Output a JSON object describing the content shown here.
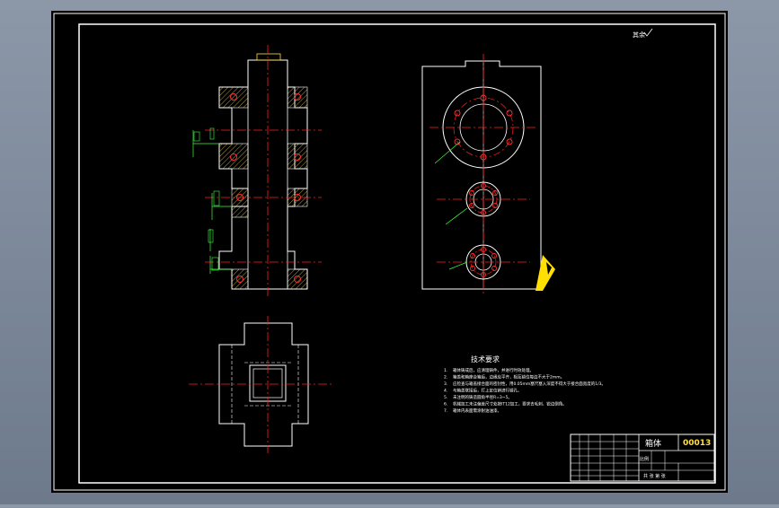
{
  "drawing": {
    "background_color": "#000000",
    "frame_color": "#ffffff",
    "centerline_color": "#ff2020",
    "hatch_color": "#d8c050",
    "dimension_color": "#40ff40",
    "surface_note": "其余",
    "requirements": {
      "title": "技术要求",
      "items": [
        {
          "num": "1.",
          "text": "箱体铸成后，应清理铸件，并进行时效处理。"
        },
        {
          "num": "2.",
          "text": "箱盖和箱座合箱后，边缘应平齐，相互错位每边不大于2mm。"
        },
        {
          "num": "3.",
          "text": "应检查与箱盖接合面的密封性，用0.05mm塞尺塞入深度不得大于接合面宽度的1/3。"
        },
        {
          "num": "4.",
          "text": "与箱盖联接后，打上定位销进行镗孔。"
        },
        {
          "num": "5.",
          "text": "未注明的铸造圆角半径R=3~5。"
        },
        {
          "num": "6.",
          "text": "机械加工未注偏差尺寸处按IT12加工，要求去毛刺、锐边倒角。"
        },
        {
          "num": "7.",
          "text": "箱体内表面需涂耐油油漆。"
        }
      ]
    },
    "title_block": {
      "part_name": "箱体",
      "drawing_number": "00013",
      "scale_label": "比例",
      "sheet_label": "共 张 第 张"
    }
  }
}
